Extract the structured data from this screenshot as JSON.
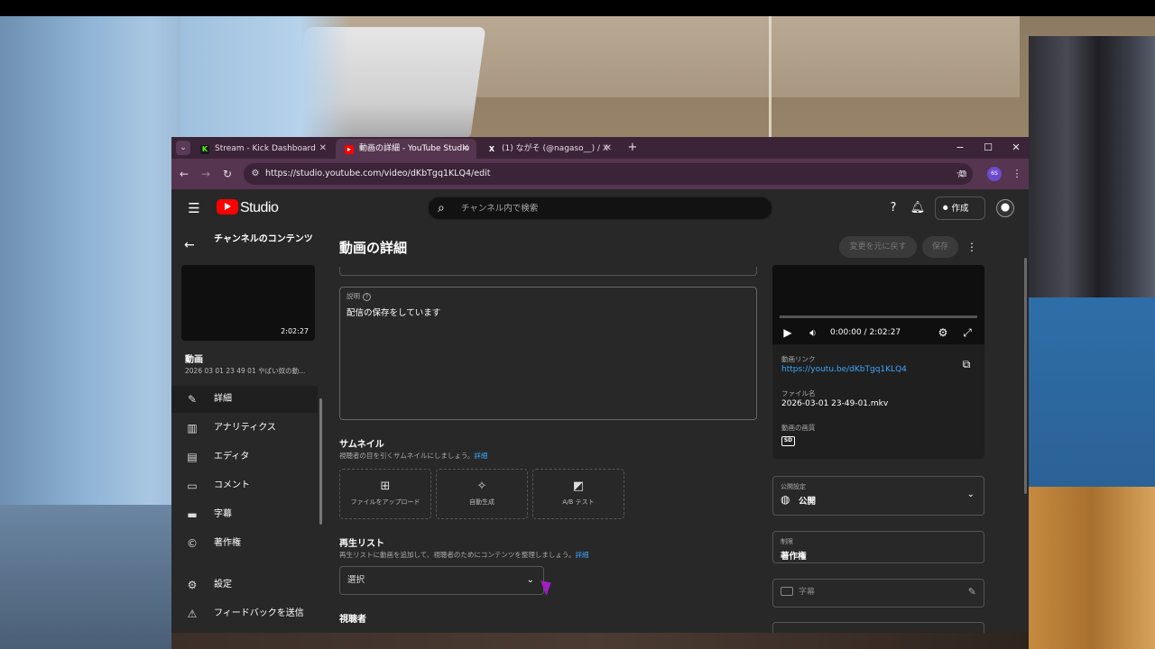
{
  "browser": {
    "tabs": [
      {
        "label": "Stream - Kick Dashboard",
        "favicon": "kick-icon",
        "favicon_color": "#53fc18",
        "active": false
      },
      {
        "label": "動画の詳細 - YouTube Studio",
        "favicon": "youtube-icon",
        "favicon_color": "#ff0000",
        "active": true
      },
      {
        "label": "(1) ながそ (@nagaso__) / X",
        "favicon": "x-icon",
        "favicon_color": "#000000",
        "active": false
      }
    ],
    "url": "https://studio.youtube.com/video/dKbTgq1KLQ4/edit",
    "profile_initials": "6S"
  },
  "masthead": {
    "logo_text": "Studio",
    "search_placeholder": "チャンネル内で検索",
    "create_label": "作成"
  },
  "sidebar": {
    "title": "チャンネルのコンテンツ",
    "thumbnail_duration": "2:02:27",
    "video_heading": "動画",
    "video_title": "2026 03 01 23 49 01 やばい奴の動...",
    "nav": [
      {
        "label": "詳細",
        "icon": "pencil-icon",
        "active": true
      },
      {
        "label": "アナリティクス",
        "icon": "analytics-icon",
        "active": false
      },
      {
        "label": "エディタ",
        "icon": "editor-icon",
        "active": false
      },
      {
        "label": "コメント",
        "icon": "comment-icon",
        "active": false
      },
      {
        "label": "字幕",
        "icon": "subtitles-icon",
        "active": false
      },
      {
        "label": "著作権",
        "icon": "copyright-icon",
        "active": false
      }
    ],
    "bottom_nav": [
      {
        "label": "設定",
        "icon": "settings-icon"
      },
      {
        "label": "フィードバックを送信",
        "icon": "feedback-icon"
      }
    ]
  },
  "main": {
    "page_title": "動画の詳細",
    "undo_label": "変更を元に戻す",
    "save_label": "保存",
    "description": {
      "label": "説明",
      "value": "配信の保存をしています"
    },
    "thumbnail": {
      "heading": "サムネイル",
      "subtitle": "視聴者の目を引くサムネイルにしましょう。",
      "link": "詳細",
      "options": [
        {
          "label": "ファイルをアップロード",
          "icon": "image-upload-icon"
        },
        {
          "label": "自動生成",
          "icon": "sparkle-icon"
        },
        {
          "label": "A/B テスト",
          "icon": "ab-test-icon"
        }
      ]
    },
    "playlist": {
      "heading": "再生リスト",
      "subtitle": "再生リストに動画を追加して、視聴者のためにコンテンツを整理しましょう。",
      "link": "詳細",
      "select_value": "選択"
    },
    "audience_heading": "視聴者"
  },
  "video_card": {
    "time": "0:00:00 / 2:02:27",
    "link_label": "動画リンク",
    "link_value": "https://youtu.be/dKbTgq1KLQ4",
    "filename_label": "ファイル名",
    "filename_value": "2026-03-01 23-49-01.mkv",
    "quality_label": "動画の画質",
    "quality_badge": "SD"
  },
  "right": {
    "visibility_label": "公開設定",
    "visibility_value": "公開",
    "restriction_label": "制限",
    "restriction_value": "著作権",
    "subtitles_label": "字幕"
  }
}
